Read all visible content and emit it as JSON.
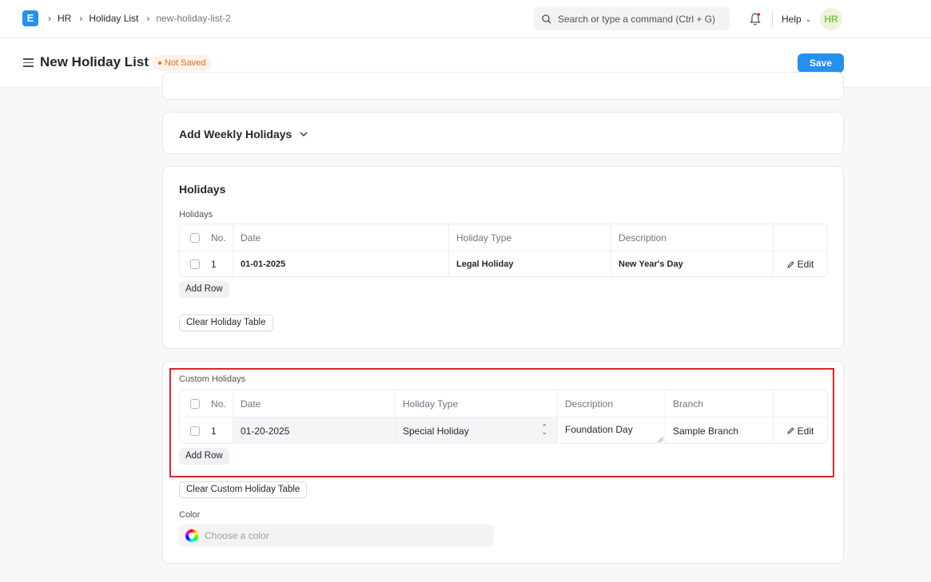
{
  "navbar": {
    "logo_letter": "E",
    "breadcrumbs": [
      "HR",
      "Holiday List",
      "new-holiday-list-2"
    ],
    "search_placeholder": "Search or type a command (Ctrl + G)",
    "help_label": "Help",
    "avatar_initials": "HR"
  },
  "page": {
    "title": "New Holiday List",
    "status": "Not Saved",
    "save_label": "Save"
  },
  "weekly": {
    "title": "Add Weekly Holidays"
  },
  "holidays": {
    "section_title": "Holidays",
    "table_label": "Holidays",
    "columns": [
      "No.",
      "Date",
      "Holiday Type",
      "Description"
    ],
    "rows": [
      {
        "no": "1",
        "date": "01-01-2025",
        "holiday_type": "Legal Holiday",
        "description": "New Year's Day",
        "edit": "Edit"
      }
    ],
    "add_row_label": "Add Row",
    "clear_label": "Clear Holiday Table"
  },
  "custom_holidays": {
    "table_label": "Custom Holidays",
    "columns": [
      "No.",
      "Date",
      "Holiday Type",
      "Description",
      "Branch"
    ],
    "rows": [
      {
        "no": "1",
        "date": "01-20-2025",
        "holiday_type": "Special Holiday",
        "description": "Foundation Day",
        "branch": "Sample Branch",
        "edit": "Edit"
      }
    ],
    "add_row_label": "Add Row",
    "clear_label": "Clear Custom Holiday Table"
  },
  "color": {
    "label": "Color",
    "placeholder": "Choose a color"
  },
  "colors": {
    "primary": "#2490ef",
    "highlight": "#e0242b",
    "not_saved": "#e86c13"
  }
}
